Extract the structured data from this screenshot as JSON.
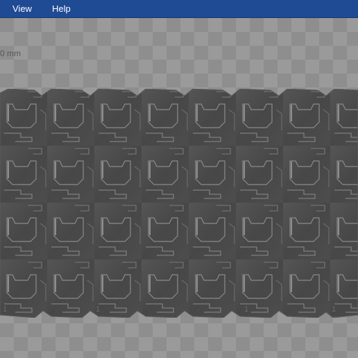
{
  "menu": {
    "view": "View",
    "help": "Help"
  },
  "viewport": {
    "scale_top": "0 mm",
    "bottom_ticks": [
      "1",
      "1",
      "1",
      "1",
      "1",
      "1",
      "1",
      "1"
    ]
  },
  "model": {
    "description_icon": "tiled-3d-part"
  },
  "colors": {
    "menubar": "#1f4a94",
    "part": "#4a4a4a",
    "part_edge": "#6b6b6b",
    "checker_light": "#9a9a9a",
    "checker_dark": "#8e8e8e"
  }
}
